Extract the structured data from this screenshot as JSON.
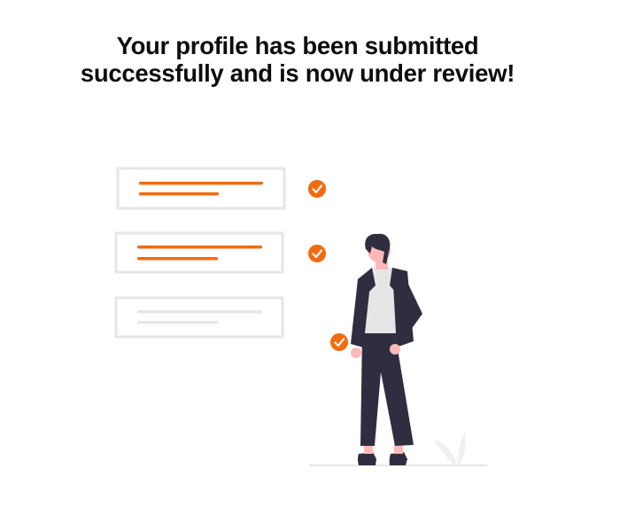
{
  "message": {
    "line1": "Your profile has been submitted",
    "line2": "successfully and is now under review!"
  },
  "illustration": {
    "checklist_items": [
      {
        "state": "checked"
      },
      {
        "state": "checked"
      },
      {
        "state": "pending"
      }
    ],
    "icons": [
      "checkmark-icon"
    ]
  },
  "colors": {
    "accent": "#f26b0f",
    "text": "#0d0d0d",
    "suit": "#2f2e41",
    "shirt": "#e6e6e6",
    "skin": "#ffb8b8",
    "box_border": "#e6e6e6",
    "pending_line": "#e6e6e6"
  }
}
